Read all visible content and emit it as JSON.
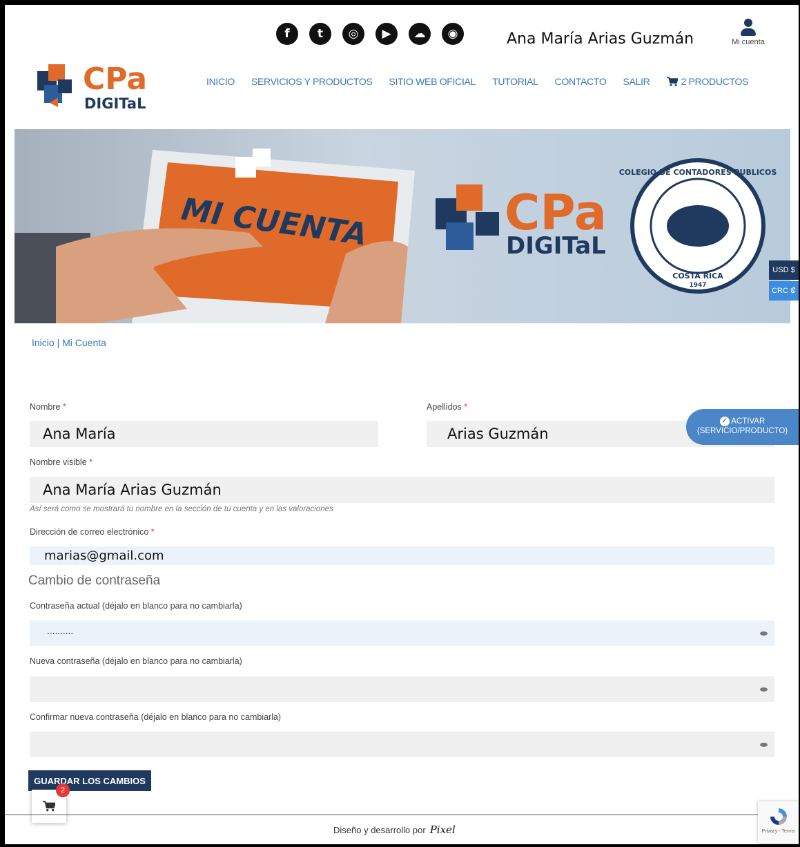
{
  "header": {
    "social_icons": [
      {
        "name": "facebook-icon",
        "glyph": "f"
      },
      {
        "name": "twitter-icon",
        "glyph": "t"
      },
      {
        "name": "instagram-icon",
        "glyph": "◎"
      },
      {
        "name": "youtube-icon",
        "glyph": "▶"
      },
      {
        "name": "soundcloud-icon",
        "glyph": "☁"
      },
      {
        "name": "periscope-icon",
        "glyph": "◉"
      }
    ],
    "user_name": "Ana María Arias Guzmán",
    "account_label": "Mi cuenta"
  },
  "logo": {
    "text_top": "CPa",
    "text_bottom": "DIGITaL"
  },
  "nav": {
    "items": [
      "INICIO",
      "SERVICIOS Y PRODUCTOS",
      "SITIO WEB OFICIAL",
      "TUTORIAL",
      "CONTACTO",
      "SALIR"
    ],
    "cart_label": "2 PRODUCTOS"
  },
  "banner": {
    "tablet_title": "MI CUENTA",
    "brand_top": "CPa",
    "brand_bottom": "DIGITaL",
    "seal_text": "COLEGIO DE CONTADORES PUBLICOS",
    "seal_country": "COSTA RICA",
    "seal_year": "1947"
  },
  "currency": {
    "usd": "USD $",
    "crc": "CRC ₡"
  },
  "breadcrumb": "Inicio | Mi Cuenta",
  "form": {
    "nombre_label": "Nombre",
    "nombre_value": "Ana María",
    "apellidos_label": "Apellidos",
    "apellidos_value": "Arias Guzmán",
    "nombre_visible_label": "Nombre visible",
    "nombre_visible_value": "Ana María Arias Guzmán",
    "nombre_visible_hint": "Así será como se mostrará tu nombre en la sección de tu cuenta y en las valoraciones",
    "email_label": "Dirección de correo electrónico",
    "email_value": "marias@gmail.com",
    "required_mark": "*",
    "password_section_title": "Cambio de contraseña",
    "current_password_label": "Contraseña actual (déjalo en blanco para no cambiarla)",
    "current_password_value": "··········",
    "new_password_label": "Nueva contraseña (déjalo en blanco para no cambiarla)",
    "confirm_password_label": "Confirmar nueva contraseña (déjalo en blanco para no cambiarla)",
    "save_button": "GUARDAR LOS CAMBIOS"
  },
  "activar": {
    "line1": "ACTIVAR",
    "line2": "(SERVICIO/PRODUCTO)"
  },
  "floating_cart": {
    "count": "2"
  },
  "footer": {
    "text": "Diseño y desarrollo por",
    "brand": "Pixel"
  },
  "recaptcha": {
    "text": "Privacy - Terms"
  },
  "colors": {
    "primary": "#1f3a5e",
    "link": "#3a76b8",
    "orange": "#e06a2a",
    "accent": "#4a86c8",
    "required": "#e53935"
  }
}
